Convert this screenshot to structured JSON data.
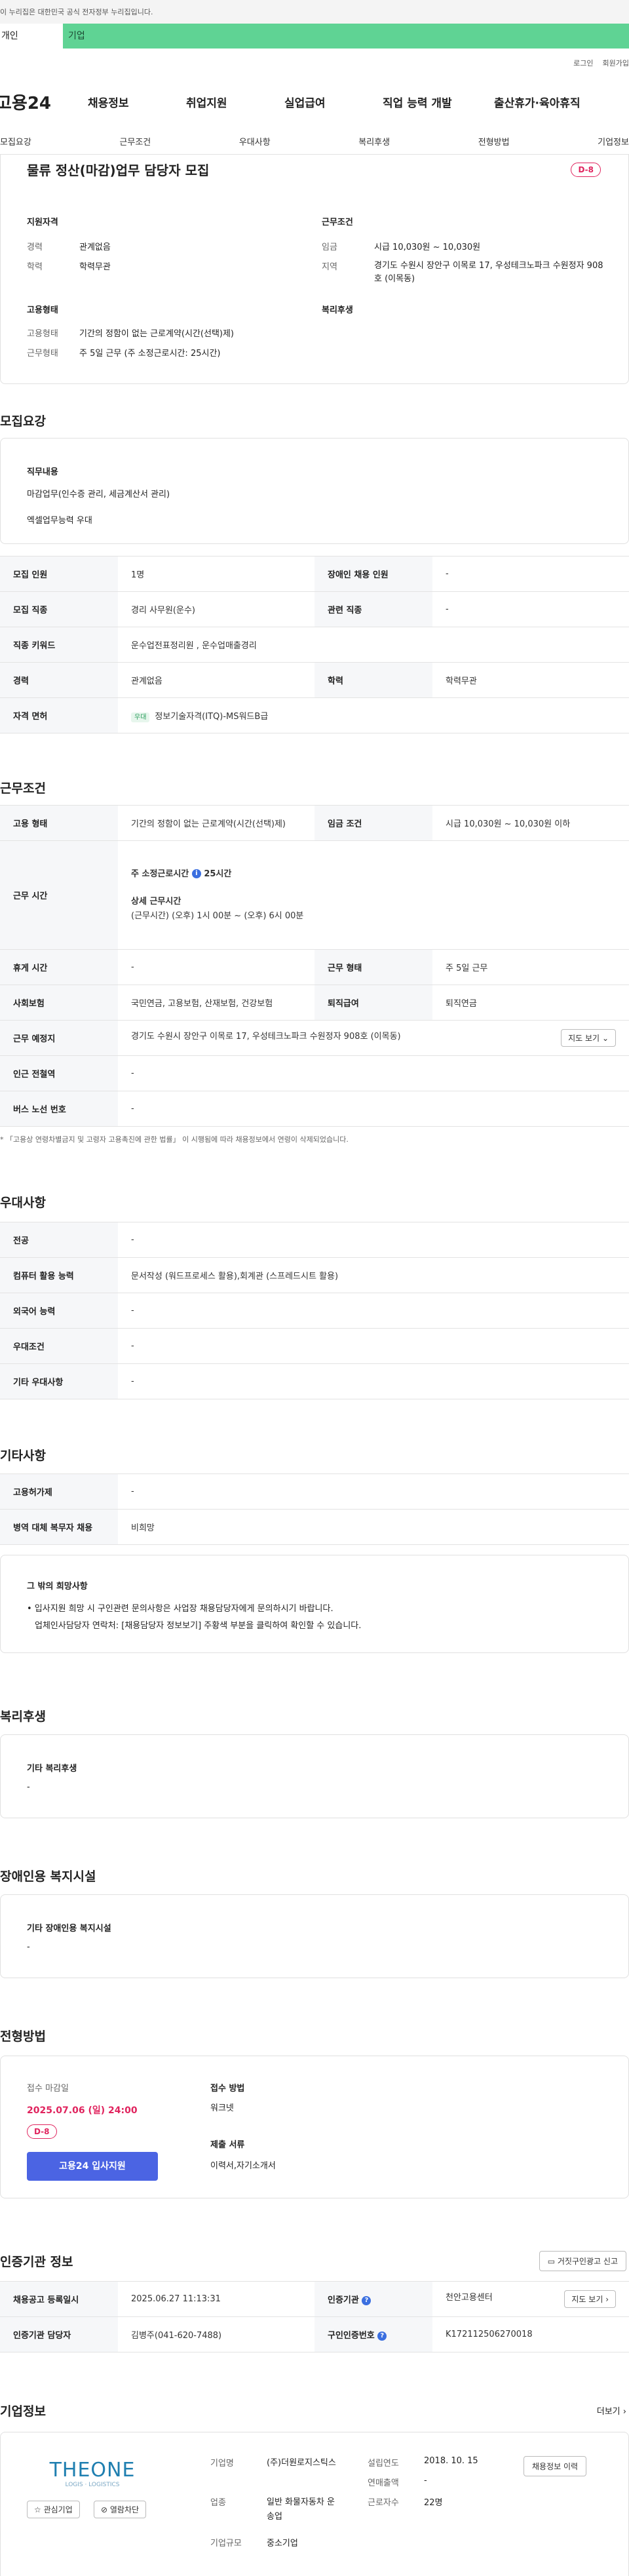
{
  "gov_banner": "이 누리집은 대한민국 공식 전자정부 누리집입니다.",
  "tabs": [
    "개인",
    "기업"
  ],
  "util": [
    "로그인",
    "회원가입"
  ],
  "logo": "고용24",
  "gnb": [
    "채용정보",
    "취업지원",
    "실업급여",
    "직업 능력 개발",
    "출산휴가·육아휴직"
  ],
  "subnav": [
    "모집요강",
    "근무조건",
    "우대사항",
    "복리후생",
    "전형방법",
    "기업정보"
  ],
  "summary": {
    "title": "물류 정산(마감)업무 담당자 모집",
    "dday": "D-8",
    "qual_title": "지원자격",
    "exp_l": "경력",
    "exp_v": "관계없음",
    "edu_l": "학력",
    "edu_v": "학력무관",
    "work_title": "근무조건",
    "wage_l": "임금",
    "wage_v": "시급 10,030원 ~ 10,030원",
    "area_l": "지역",
    "area_v": "경기도 수원시 장안구 이목로 17, 우성테크노파크 수원정자 908호 (이목동)",
    "emp_title": "고용형태",
    "type_l": "고용형태",
    "type_v": "기간의 정함이 없는 근로계약(시간(선택)제)",
    "form_l": "근무형태",
    "form_v": "주 5일 근무 (주 소정근로시간: 25시간)",
    "welfare_title": "복리후생"
  },
  "req": {
    "title": "모집요강",
    "duty_title": "직무내용",
    "duty1": "마감업무(인수증 관리, 세금계산서 관리)",
    "duty2": "엑셀업무능력 우대",
    "r1k": "모집 인원",
    "r1v": "1명",
    "r1k2": "장애인 채용 인원",
    "r1v2": "-",
    "r2k": "모집 직종",
    "r2v": "경리 사무원(운수)",
    "r2k2": "관련 직종",
    "r2v2": "-",
    "r3k": "직종 키워드",
    "r3v": "운수업전표정리원 , 운수업매출경리",
    "r4k": "경력",
    "r4v": "관계없음",
    "r4k2": "학력",
    "r4v2": "학력무관",
    "r5k": "자격 면허",
    "r5tag": "우대",
    "r5v": "정보기술자격(ITQ)-MS워드B급"
  },
  "cond": {
    "title": "근무조건",
    "c1k": "고용 형태",
    "c1v": "기간의 정함이 없는 근로계약(시간(선택)제)",
    "c1k2": "임금 조건",
    "c1v2": "시급 10,030원 ~ 10,030원 이하",
    "c2k": "근무 시간",
    "c2a": "주 소정근로시간",
    "c2b": "25시간",
    "c2c": "상세 근무시간",
    "c2d": "(근무시간) (오후) 1시 00분 ~ (오후) 6시 00분",
    "c3k": "휴게 시간",
    "c3v": "-",
    "c3k2": "근무 형태",
    "c3v2": "주 5일 근무",
    "c4k": "사회보험",
    "c4v": "국민연금, 고용보험, 산재보험, 건강보험",
    "c4k2": "퇴직급여",
    "c4v2": "퇴직연금",
    "c5k": "근무 예정지",
    "c5v": "경기도 수원시 장안구 이목로 17, 우성테크노파크 수원정자 908호 (이목동)",
    "map": "지도 보기",
    "c6k": "인근 전철역",
    "c6v": "-",
    "c7k": "버스 노선 번호",
    "c7v": "-",
    "note": "* 「고용상 연령차별금지 및 고령자 고용촉진에 관한 법률」 이 시행됨에 따라 채용정보에서 연령이 삭제되었습니다."
  },
  "pref": {
    "title": "우대사항",
    "p1k": "전공",
    "p1v": "-",
    "p2k": "컴퓨터 활용 능력",
    "p2v": "문서작성 (워드프로세스 활용),회계관 (스프레드시트 활용)",
    "p3k": "외국어 능력",
    "p3v": "-",
    "p4k": "우대조건",
    "p4v": "-",
    "p5k": "기타 우대사항",
    "p5v": "-"
  },
  "etc": {
    "title": "기타사항",
    "e1k": "고용허가제",
    "e1v": "-",
    "e2k": "병역 대체 복무자 채용",
    "e2v": "비희망",
    "hope_title": "그 밖의 희망사항",
    "hope1": "• 입사지원 희망 시 구인관련 문의사항은 사업장 채용담당자에게 문의하시기 바랍니다.",
    "hope2": "업체인사담당자 연락처: [채용담당자 정보보기] 주황색 부분을 클릭하여 확인할 수 있습니다."
  },
  "welfare": {
    "title": "복리후생",
    "sub": "기타 복리후생",
    "v": "-"
  },
  "dis": {
    "title": "장애인용 복지시설",
    "sub": "기타 장애인용 복지시설",
    "v": "-"
  },
  "sel": {
    "title": "전형방법",
    "deadline_l": "접수 마감일",
    "deadline": "2025.07.06 (일) 24:00",
    "dday": "D-8",
    "apply": "고용24 입사지원",
    "method_l": "접수 방법",
    "method": "워크넷",
    "docs_l": "제출 서류",
    "docs": "이력서,자기소개서"
  },
  "cert": {
    "title": "인증기관 정보",
    "report": "거짓구인광고 신고",
    "k1": "채용공고 등록일시",
    "v1": "2025.06.27 11:13:31",
    "k2": "인증기관",
    "v2": "천안고용센터",
    "map": "지도 보기",
    "k3": "인증기관 담당자",
    "v3": "김병주(041-620-7488)",
    "k4": "구인인증번호",
    "v4": "K172112506270018"
  },
  "corp": {
    "title": "기업정보",
    "more": "더보기",
    "logo": "THEONE",
    "logo_sub": "LOGIS · LOGISTICS",
    "like": "관심기업",
    "block": "열람차단",
    "name_l": "기업명",
    "name": "(주)더원로지스틱스",
    "ind_l": "업종",
    "ind": "일반 화물자동차 운송업",
    "size_l": "기업규모",
    "size": "중소기업",
    "est_l": "설립연도",
    "est": "2018. 10. 15",
    "sales_l": "연매출액",
    "sales": "-",
    "emp_l": "근로자수",
    "emp": "22명",
    "hist": "채용정보 이력"
  }
}
